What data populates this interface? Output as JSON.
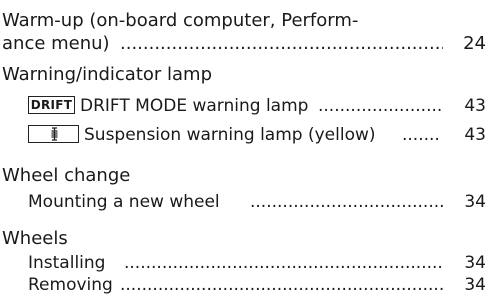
{
  "entries": {
    "warmup_line1": "Warm-up (on-board computer, Perform-",
    "warmup_line2": "ance menu)",
    "warmup_page": "24",
    "warning_lamp": "Warning/indicator lamp",
    "drift_badge": "DRIFT",
    "drift_text": "DRIFT MODE warning lamp",
    "drift_page": "43",
    "suspension_text": "Suspension warning lamp (yellow)",
    "suspension_page": "43",
    "wheel_change": "Wheel change",
    "mounting_text": "Mounting a new wheel",
    "mounting_page": "34",
    "wheels": "Wheels",
    "installing_text": "Installing",
    "installing_page": "34",
    "removing_text": "Removing",
    "removing_page": "34"
  },
  "icons": {
    "suspension": "suspension-warning-icon"
  }
}
